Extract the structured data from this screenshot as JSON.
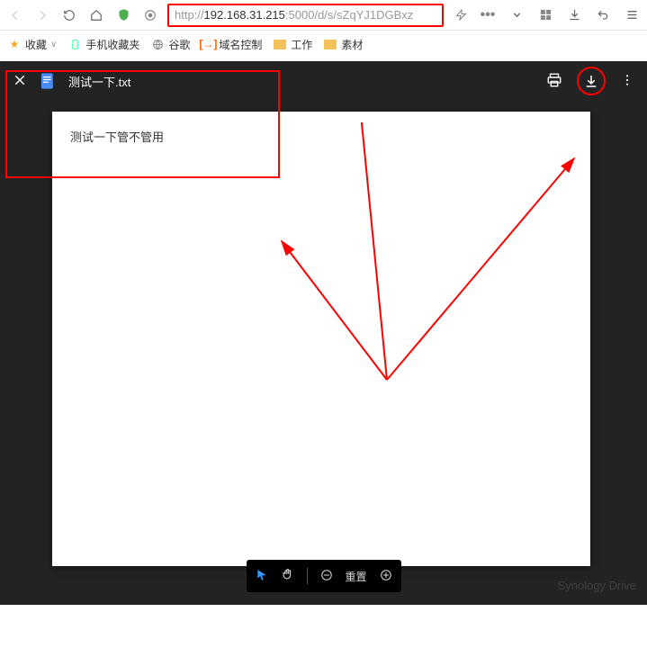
{
  "browser": {
    "url_prefix": "http://",
    "url_host": "192.168.31.215",
    "url_port": ":5000",
    "url_path": "/d/s/sZqYJ1DGBxz"
  },
  "bookmarks": {
    "fav": "收藏",
    "mobile": "手机收藏夹",
    "google": "谷歌",
    "domain": "域名控制",
    "work": "工作",
    "material": "素材"
  },
  "viewer": {
    "filename": "测试一下.txt",
    "content": "测试一下管不管用"
  },
  "toolbar": {
    "reset": "重置"
  },
  "watermark": "Synology Drive",
  "colors": {
    "highlight": "#ff0000",
    "dark": "#232323"
  }
}
